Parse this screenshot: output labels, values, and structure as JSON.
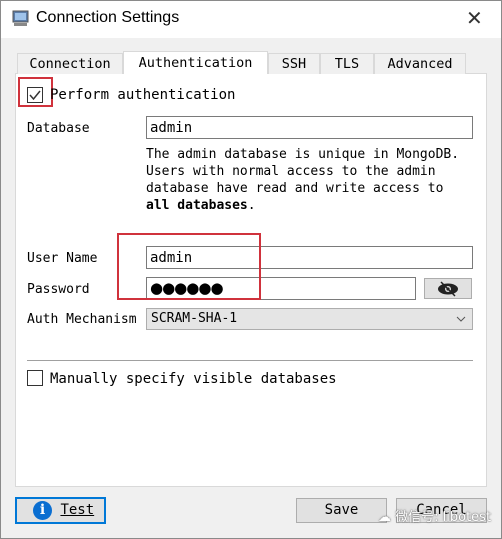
{
  "window": {
    "title": "Connection Settings"
  },
  "tabs": [
    {
      "label": "Connection"
    },
    {
      "label": "Authentication",
      "selected": true
    },
    {
      "label": "SSH"
    },
    {
      "label": "TLS"
    },
    {
      "label": "Advanced"
    }
  ],
  "auth": {
    "perform_label": "Perform authentication",
    "perform_checked": true,
    "database_label": "Database",
    "database_value": "admin",
    "desc_lines": [
      "The  admin  database  is  unique  in  MongoDB.",
      "Users with normal access to the admin",
      "database have read and write access to"
    ],
    "desc_bold": "all databases",
    "desc_end": ".",
    "username_label": "User Name",
    "username_value": "admin",
    "password_label": "Password",
    "password_value": "●●●●●●",
    "mechanism_label": "Auth Mechanism",
    "mechanism_value": "SCRAM-SHA-1",
    "manual_label": "Manually specify visible databases",
    "manual_checked": false
  },
  "footer": {
    "test_label": "Test",
    "save_label": "Save",
    "cancel_label": "Cancel"
  },
  "watermark": "微信号: libotest",
  "colors": {
    "highlight": "#d0323c",
    "info": "#0a6ed1"
  }
}
